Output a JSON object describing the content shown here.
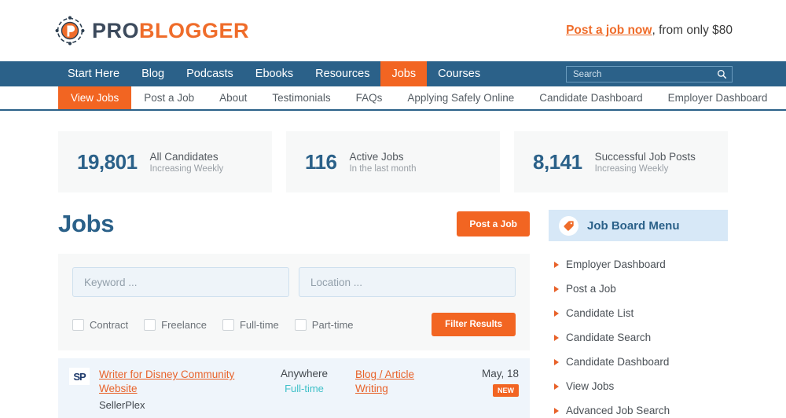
{
  "brand": {
    "logo_pro": "PRO",
    "logo_blogger": "BLOGGER",
    "logo_icon": "problogger-p-emblem-icon"
  },
  "header": {
    "cta_link": "Post a job now",
    "cta_rest": ", from only $80"
  },
  "primary_nav": {
    "items": [
      {
        "label": "Start Here",
        "active": false
      },
      {
        "label": "Blog",
        "active": false
      },
      {
        "label": "Podcasts",
        "active": false
      },
      {
        "label": "Ebooks",
        "active": false
      },
      {
        "label": "Resources",
        "active": false
      },
      {
        "label": "Jobs",
        "active": true
      },
      {
        "label": "Courses",
        "active": false
      }
    ]
  },
  "search": {
    "placeholder": "Search",
    "icon": "search-icon"
  },
  "secondary_nav": {
    "items": [
      {
        "label": "View Jobs",
        "active": true
      },
      {
        "label": "Post a Job",
        "active": false
      },
      {
        "label": "About",
        "active": false
      },
      {
        "label": "Testimonials",
        "active": false
      },
      {
        "label": "FAQs",
        "active": false
      },
      {
        "label": "Applying Safely Online",
        "active": false
      },
      {
        "label": "Candidate Dashboard",
        "active": false
      },
      {
        "label": "Employer Dashboard",
        "active": false
      }
    ]
  },
  "stats": [
    {
      "number": "19,801",
      "label": "All Candidates",
      "sub": "Increasing Weekly"
    },
    {
      "number": "116",
      "label": "Active Jobs",
      "sub": "In the last month"
    },
    {
      "number": "8,141",
      "label": "Successful Job Posts",
      "sub": "Increasing Weekly"
    }
  ],
  "jobs_section": {
    "title": "Jobs",
    "post_button": "Post a Job"
  },
  "filters": {
    "keyword_placeholder": "Keyword ...",
    "location_placeholder": "Location ...",
    "keyword_value": "",
    "location_value": "",
    "checkboxes": [
      {
        "label": "Contract",
        "checked": false
      },
      {
        "label": "Freelance",
        "checked": false
      },
      {
        "label": "Full-time",
        "checked": false
      },
      {
        "label": "Part-time",
        "checked": false
      }
    ],
    "submit_label": "Filter Results"
  },
  "listings": [
    {
      "logo_text": "SP",
      "title": "Writer for Disney Community Website",
      "company": "SellerPlex",
      "location": "Anywhere",
      "type": "Full-time",
      "category": "Blog / Article Writing",
      "date": "May, 18",
      "badge": "NEW"
    }
  ],
  "sidebar": {
    "header_title": "Job Board Menu",
    "header_icon": "tag-icon",
    "items": [
      {
        "label": "Employer Dashboard"
      },
      {
        "label": "Post a Job"
      },
      {
        "label": "Candidate List"
      },
      {
        "label": "Candidate Search"
      },
      {
        "label": "Candidate Dashboard"
      },
      {
        "label": "View Jobs"
      },
      {
        "label": "Advanced Job Search"
      }
    ]
  },
  "colors": {
    "brand_orange": "#f26522",
    "brand_blue": "#2b6189",
    "link_orange": "#e8622a",
    "teal": "#3fc0c8"
  }
}
